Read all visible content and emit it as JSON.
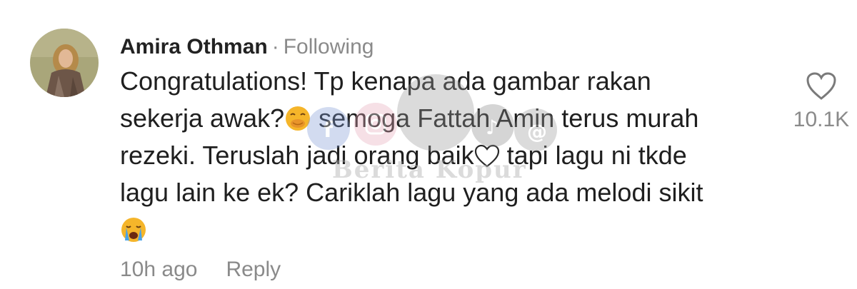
{
  "comment": {
    "author": "Amira Othman",
    "separator": "·",
    "follow_status": "Following",
    "text_lines": [
      "Congratulations! Tp kenapa ada gambar rakan",
      [
        "sekerja awak?",
        " semoga Fattah Amin terus murah"
      ],
      [
        "rezeki. Teruslah jadi orang baik",
        " tapi lagu ni tkde"
      ],
      "lagu lain ke ek? Cariklah lagu yang ada melodi sikit"
    ],
    "line1": "Congratulations! Tp kenapa ada gambar rakan",
    "line2a": "sekerja awak?",
    "line2b": " semoga Fattah Amin terus murah",
    "line3a": "rezeki. Teruslah jadi orang baik",
    "line3b": " tapi lagu ni tkde",
    "line4": "lagu lain ke ek? Cariklah lagu yang ada melodi sikit",
    "emojis": [
      "face-with-hand-over-mouth-emoji",
      "white-heart-emoji",
      "loudly-crying-face-emoji"
    ],
    "timestamp": "10h ago",
    "reply_label": "Reply",
    "like_count": "10.1K"
  },
  "watermark": {
    "text": "Berita Kopur",
    "icons": [
      "facebook-icon",
      "instagram-icon",
      "tiktok-icon",
      "threads-icon"
    ]
  },
  "colors": {
    "author": "#222222",
    "muted": "#8a8a8a",
    "body": "#1f1f1f",
    "background": "#ffffff"
  }
}
